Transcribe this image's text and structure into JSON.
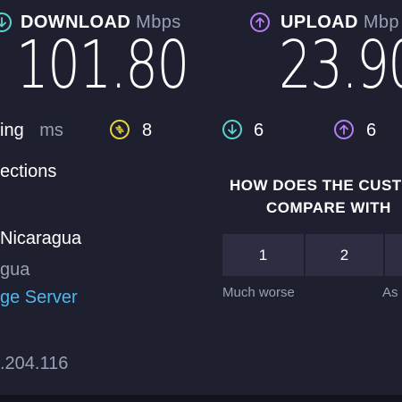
{
  "download": {
    "label": "DOWNLOAD",
    "unit": "Mbps",
    "value": "101.80",
    "icon": "download-arrow-icon",
    "color": "#5ad3d1"
  },
  "upload": {
    "label": "UPLOAD",
    "unit": "Mbp",
    "value": "23.90",
    "icon": "upload-arrow-icon",
    "color": "#b47ef5"
  },
  "ping": {
    "label": "ing",
    "unit": "ms"
  },
  "jitter": {
    "value": "8",
    "icon": "jitter-icon",
    "color": "#e8d53a"
  },
  "download_latency": {
    "value": "6",
    "icon": "download-latency-icon",
    "color": "#5ad3d1"
  },
  "upload_latency": {
    "value": "6",
    "icon": "upload-latency-icon",
    "color": "#b47ef5"
  },
  "connections": {
    "label": "ections"
  },
  "isp": {
    "location": "Nicaragua",
    "country": "gua",
    "change_server": "ge Server",
    "ip": ".204.116"
  },
  "survey": {
    "question_line1": "HOW DOES THE CUST",
    "question_line2": "COMPARE WITH",
    "options": [
      "1",
      "2"
    ],
    "low_label": "Much worse",
    "high_label": "As"
  }
}
